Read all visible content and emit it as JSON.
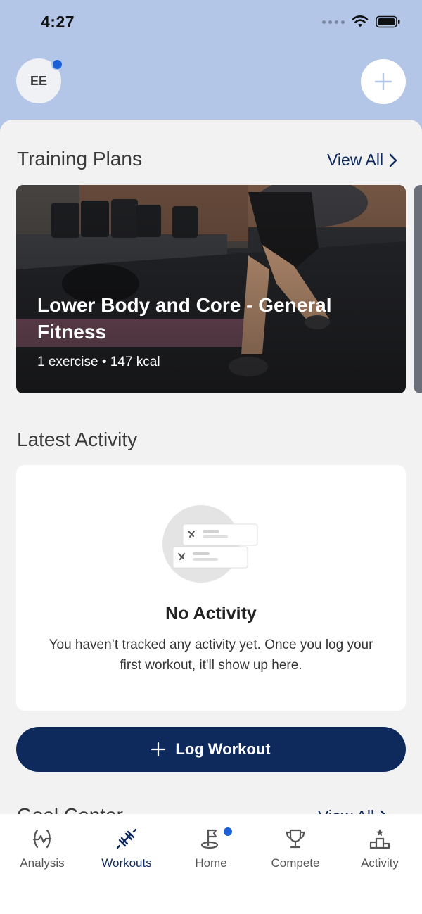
{
  "status": {
    "time": "4:27"
  },
  "header": {
    "avatar_initials": "EE"
  },
  "training": {
    "title": "Training Plans",
    "view_all": "View All",
    "card": {
      "title": "Lower Body and Core - General Fitness",
      "meta": "1 exercise • 147 kcal"
    }
  },
  "latest": {
    "title": "Latest Activity",
    "empty_title": "No Activity",
    "empty_text": "You haven’t tracked any activity yet. Once you log your first workout, it'll show up here."
  },
  "log_workout": {
    "label": "Log Workout"
  },
  "goal": {
    "title": "Goal Center",
    "view_all": "View All"
  },
  "tabs": [
    {
      "label": "Analysis",
      "icon": "analysis-icon"
    },
    {
      "label": "Workouts",
      "icon": "dumbbell-icon"
    },
    {
      "label": "Home",
      "icon": "home-flag-icon"
    },
    {
      "label": "Compete",
      "icon": "trophy-icon"
    },
    {
      "label": "Activity",
      "icon": "podium-icon"
    }
  ],
  "active_tab": "Workouts",
  "colors": {
    "accent": "#0e2a5c",
    "header_bg": "#b3c6e8",
    "badge": "#1b5fd6",
    "sheet_bg": "#f2f2f2"
  }
}
